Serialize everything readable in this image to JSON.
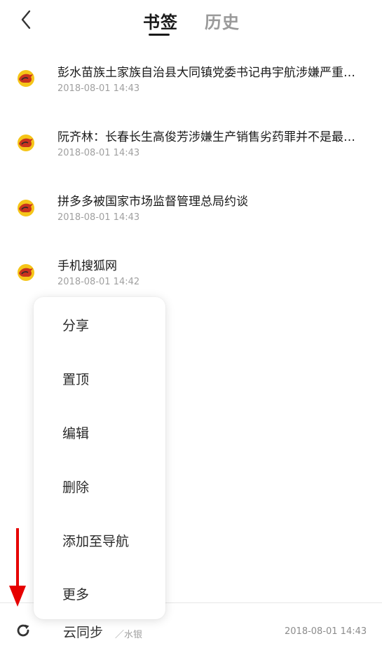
{
  "header": {
    "tabs": [
      {
        "label": "书签",
        "active": true
      },
      {
        "label": "历史",
        "active": false
      }
    ]
  },
  "bookmarks": [
    {
      "title": "彭水苗族土家族自治县大同镇党委书记冉宇航涉嫌严重违纪违法接受纪律审查和监察调查",
      "date": "2018-08-01 14:43",
      "icon": "sohu-fox-icon"
    },
    {
      "title": "阮齐林：长春长生高俊芳涉嫌生产销售劣药罪并不是最重的罪名",
      "date": "2018-08-01 14:43",
      "icon": "sohu-fox-icon"
    },
    {
      "title": "拼多多被国家市场监督管理总局约谈",
      "date": "2018-08-01 14:43",
      "icon": "sohu-fox-icon"
    },
    {
      "title": "手机搜狐网",
      "date": "2018-08-01 14:42",
      "icon": "sohu-fox-icon"
    }
  ],
  "context_menu": {
    "items": [
      "分享",
      "置顶",
      "编辑",
      "删除",
      "添加至导航",
      "更多"
    ]
  },
  "bottom_bar": {
    "sync_label": "云同步",
    "sync_user": "／水银",
    "sync_time": "2018-08-01 14:43",
    "icon": "sync-icon"
  },
  "colors": {
    "accent_yellow": "#f5c518",
    "fox_red": "#c8321e",
    "annotation_arrow": "#e60000"
  }
}
